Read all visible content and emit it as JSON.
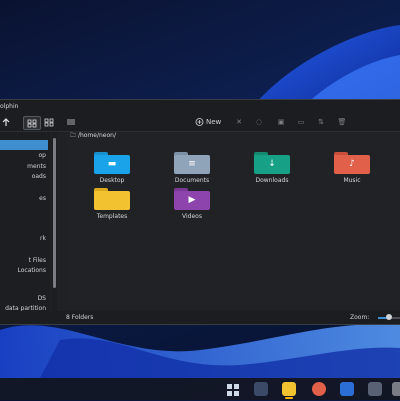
{
  "window": {
    "title": "olphin",
    "path": "/home/neon/"
  },
  "toolbar": {
    "back_icon": "back-arrow-icon",
    "new_label": "New",
    "new_icon": "plus-circle-icon"
  },
  "sidebar": {
    "items": [
      {
        "label": ""
      },
      {
        "label": "op"
      },
      {
        "label": "ments"
      },
      {
        "label": "oads"
      },
      {
        "label": ""
      },
      {
        "label": "es"
      },
      {
        "label": ""
      },
      {
        "label": ""
      },
      {
        "label": ""
      },
      {
        "label": "rk"
      },
      {
        "label": ""
      },
      {
        "label": "t Files"
      },
      {
        "label": "Locations"
      },
      {
        "label": ""
      },
      {
        "label": ""
      },
      {
        "label": "DS"
      },
      {
        "label": "data partition"
      }
    ]
  },
  "folders": [
    {
      "name": "Desktop",
      "color": "#1aa3e8",
      "icon": "desktop-folder-icon"
    },
    {
      "name": "Documents",
      "color": "#8fa4b8",
      "icon": "documents-folder-icon"
    },
    {
      "name": "Downloads",
      "color": "#16a085",
      "icon": "downloads-folder-icon"
    },
    {
      "name": "Music",
      "color": "#e0604a",
      "icon": "music-folder-icon"
    },
    {
      "name": "Templates",
      "color": "#f2c230",
      "icon": "templates-folder-icon"
    },
    {
      "name": "Videos",
      "color": "#8e44ad",
      "icon": "videos-folder-icon"
    }
  ],
  "status": {
    "count": "8 Folders",
    "zoom_label": "Zoom:",
    "zoom_level": 0.5
  },
  "colors": {
    "accent": "#3d8fd0",
    "window_bg": "#1f2124"
  }
}
